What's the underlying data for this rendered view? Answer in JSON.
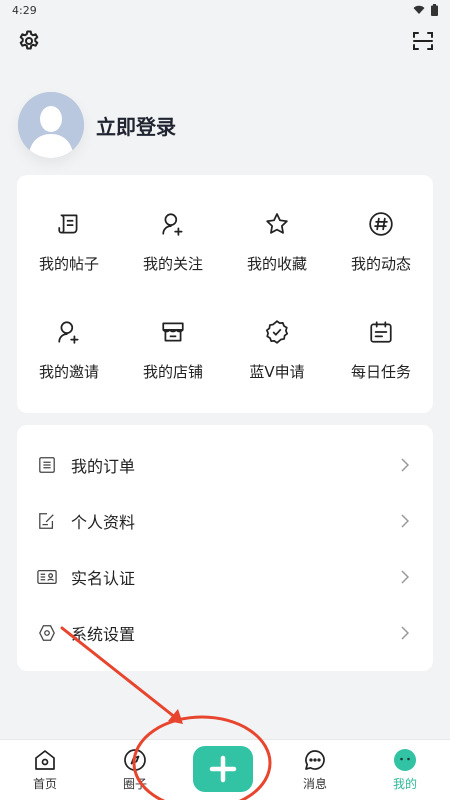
{
  "status_bar": {
    "time": "4:29"
  },
  "profile": {
    "login_label": "立即登录"
  },
  "grid_items": [
    {
      "label": "我的帖子",
      "icon": "posts-icon"
    },
    {
      "label": "我的关注",
      "icon": "follow-user-icon"
    },
    {
      "label": "我的收藏",
      "icon": "star-icon"
    },
    {
      "label": "我的动态",
      "icon": "hashtag-icon"
    },
    {
      "label": "我的邀请",
      "icon": "invite-user-icon"
    },
    {
      "label": "我的店铺",
      "icon": "store-icon"
    },
    {
      "label": "蓝V申请",
      "icon": "verified-badge-icon"
    },
    {
      "label": "每日任务",
      "icon": "calendar-icon"
    }
  ],
  "list_items": [
    {
      "label": "我的订单",
      "icon": "order-list-icon"
    },
    {
      "label": "个人资料",
      "icon": "edit-profile-icon"
    },
    {
      "label": "实名认证",
      "icon": "id-card-icon"
    },
    {
      "label": "系统设置",
      "icon": "hexagon-settings-icon"
    }
  ],
  "bottom_nav": {
    "items": [
      {
        "label": "首页",
        "icon": "home-icon"
      },
      {
        "label": "圈子",
        "icon": "compass-icon"
      },
      {
        "label": "消息",
        "icon": "message-icon"
      },
      {
        "label": "我的",
        "icon": "mine-face-icon"
      }
    ],
    "active": "我的"
  },
  "colors": {
    "accent": "#32c3a5",
    "background": "#f2f3f4",
    "annotation_red": "#e8452f"
  }
}
